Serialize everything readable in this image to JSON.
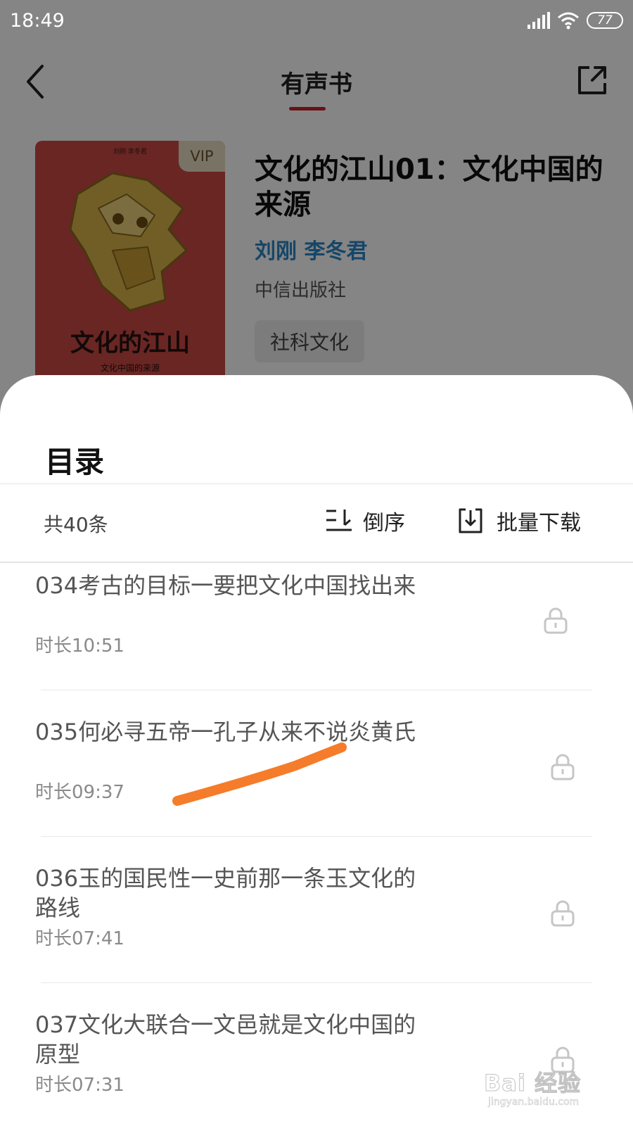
{
  "status_bar": {
    "time": "18:49",
    "battery": "77"
  },
  "nav": {
    "title": "有声书"
  },
  "book": {
    "cover_authors": "刘刚 李冬君",
    "cover_title": "文化的江山",
    "cover_subtitle": "文化中国的来源",
    "vip": "VIP",
    "title": "文化的江山01：文化中国的来源",
    "authors": "刘刚 李冬君",
    "publisher": "中信出版社",
    "tag": "社科文化"
  },
  "sheet": {
    "title": "目录",
    "total": "共40条",
    "sort_label": "倒序",
    "download_label": "批量下载"
  },
  "chapters": [
    {
      "title": "034考古的目标一要把文化中国找出来",
      "duration": "时长10:51",
      "locked": true
    },
    {
      "title": "035何必寻五帝一孔子从来不说炎黄氏",
      "duration": "时长09:37",
      "locked": true
    },
    {
      "title": "036玉的国民性一史前那一条玉文化的路线",
      "duration": "时长07:41",
      "locked": true
    },
    {
      "title": "037文化大联合一文邑就是文化中国的原型",
      "duration": "时长07:31",
      "locked": true
    }
  ],
  "watermark": {
    "main": "Bai 经验",
    "url": "jingyan.baidu.com"
  },
  "colors": {
    "accent_red": "#c8242b",
    "author_blue": "#2b86c7",
    "scribble_orange": "#f57c2a"
  }
}
